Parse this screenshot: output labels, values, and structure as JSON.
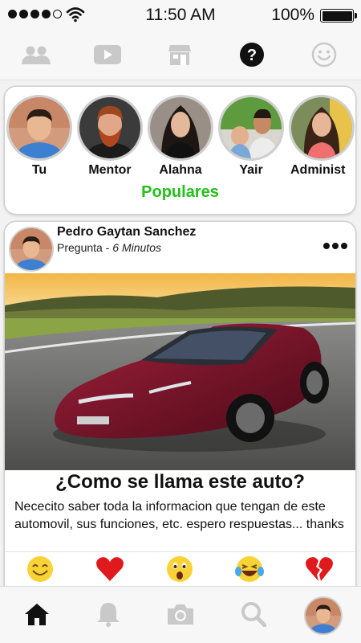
{
  "status_bar": {
    "time": "11:50 AM",
    "battery": "100%"
  },
  "top_tabs": [
    {
      "icon": "group-icon"
    },
    {
      "icon": "video-icon"
    },
    {
      "icon": "store-icon"
    },
    {
      "icon": "question-icon",
      "active": true
    },
    {
      "icon": "smiley-icon"
    }
  ],
  "stories": {
    "items": [
      {
        "name": "Tu"
      },
      {
        "name": "Mentor"
      },
      {
        "name": "Alahna"
      },
      {
        "name": "Yair"
      },
      {
        "name": "Administ"
      }
    ],
    "section_label": "Populares"
  },
  "post": {
    "author": "Pedro Gaytan Sanchez",
    "type": "Pregunta",
    "separator": " - ",
    "time": "6 Minutos",
    "question": "¿Como se llama este auto?",
    "body": "Nececito saber toda la informacion que tengan de este automovil, sus funciones, etc. espero respuestas... thanks"
  },
  "reactions": [
    "smile-icon",
    "heart-icon",
    "surprised-icon",
    "laughing-icon",
    "broken-heart-icon"
  ],
  "bottom_nav": [
    "home-icon",
    "bell-icon",
    "camera-icon",
    "search-icon",
    "profile-avatar"
  ],
  "colors": {
    "accent_green": "#22c11b",
    "heart_red": "#e0191c",
    "emoji_yellow": "#f9d236"
  }
}
